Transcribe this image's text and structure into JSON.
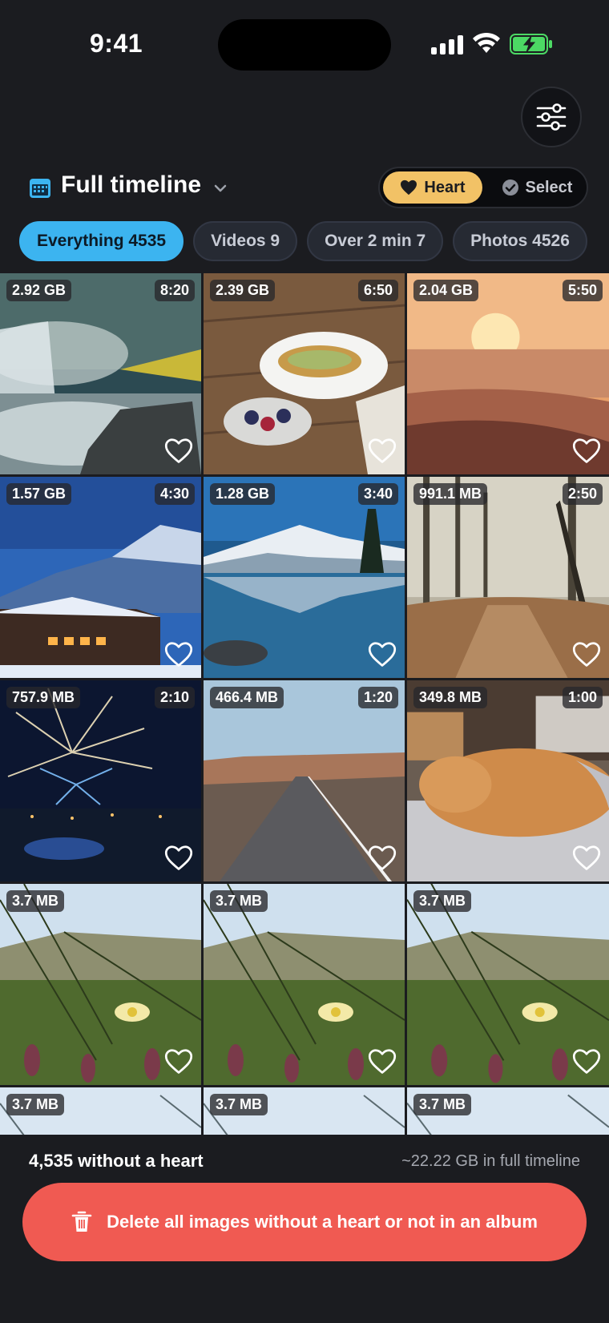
{
  "status_bar": {
    "time": "9:41"
  },
  "header": {
    "title": "Full timeline",
    "heart_label": "Heart",
    "select_label": "Select"
  },
  "chips": [
    {
      "label": "Everything 4535",
      "active": true
    },
    {
      "label": "Videos 9",
      "active": false
    },
    {
      "label": "Over 2 min 7",
      "active": false
    },
    {
      "label": "Photos 4526",
      "active": false
    }
  ],
  "tiles": [
    {
      "size": "2.92 GB",
      "duration": "8:20",
      "scene": "waterfall"
    },
    {
      "size": "2.39 GB",
      "duration": "6:50",
      "scene": "food"
    },
    {
      "size": "2.04 GB",
      "duration": "5:50",
      "scene": "sunset-beach"
    },
    {
      "size": "1.57 GB",
      "duration": "4:30",
      "scene": "snow-cabin"
    },
    {
      "size": "1.28 GB",
      "duration": "3:40",
      "scene": "mountain-lake"
    },
    {
      "size": "991.1 MB",
      "duration": "2:50",
      "scene": "forest-path"
    },
    {
      "size": "757.9 MB",
      "duration": "2:10",
      "scene": "fireworks"
    },
    {
      "size": "466.4 MB",
      "duration": "1:20",
      "scene": "desert-road"
    },
    {
      "size": "349.8 MB",
      "duration": "1:00",
      "scene": "sleeping-dog"
    },
    {
      "size": "3.7 MB",
      "duration": "",
      "scene": "flower-dune"
    },
    {
      "size": "3.7 MB",
      "duration": "",
      "scene": "flower-dune"
    },
    {
      "size": "3.7 MB",
      "duration": "",
      "scene": "flower-dune"
    },
    {
      "size": "3.7 MB",
      "duration": "",
      "scene": "sky"
    },
    {
      "size": "3.7 MB",
      "duration": "",
      "scene": "sky"
    },
    {
      "size": "3.7 MB",
      "duration": "",
      "scene": "sky"
    }
  ],
  "footer": {
    "count_text": "4,535 without a heart",
    "total_text": "~22.22 GB in full timeline",
    "delete_label": "Delete all images without a heart or not in an album"
  },
  "colors": {
    "accent_blue": "#3cb4f0",
    "heart_yellow": "#f2c266",
    "delete_red": "#f05a52",
    "background": "#1b1c20"
  },
  "icons": [
    "sliders-icon",
    "calendar-icon",
    "chevron-down-icon",
    "heart-icon",
    "checkmark-circle-icon",
    "trash-icon"
  ]
}
